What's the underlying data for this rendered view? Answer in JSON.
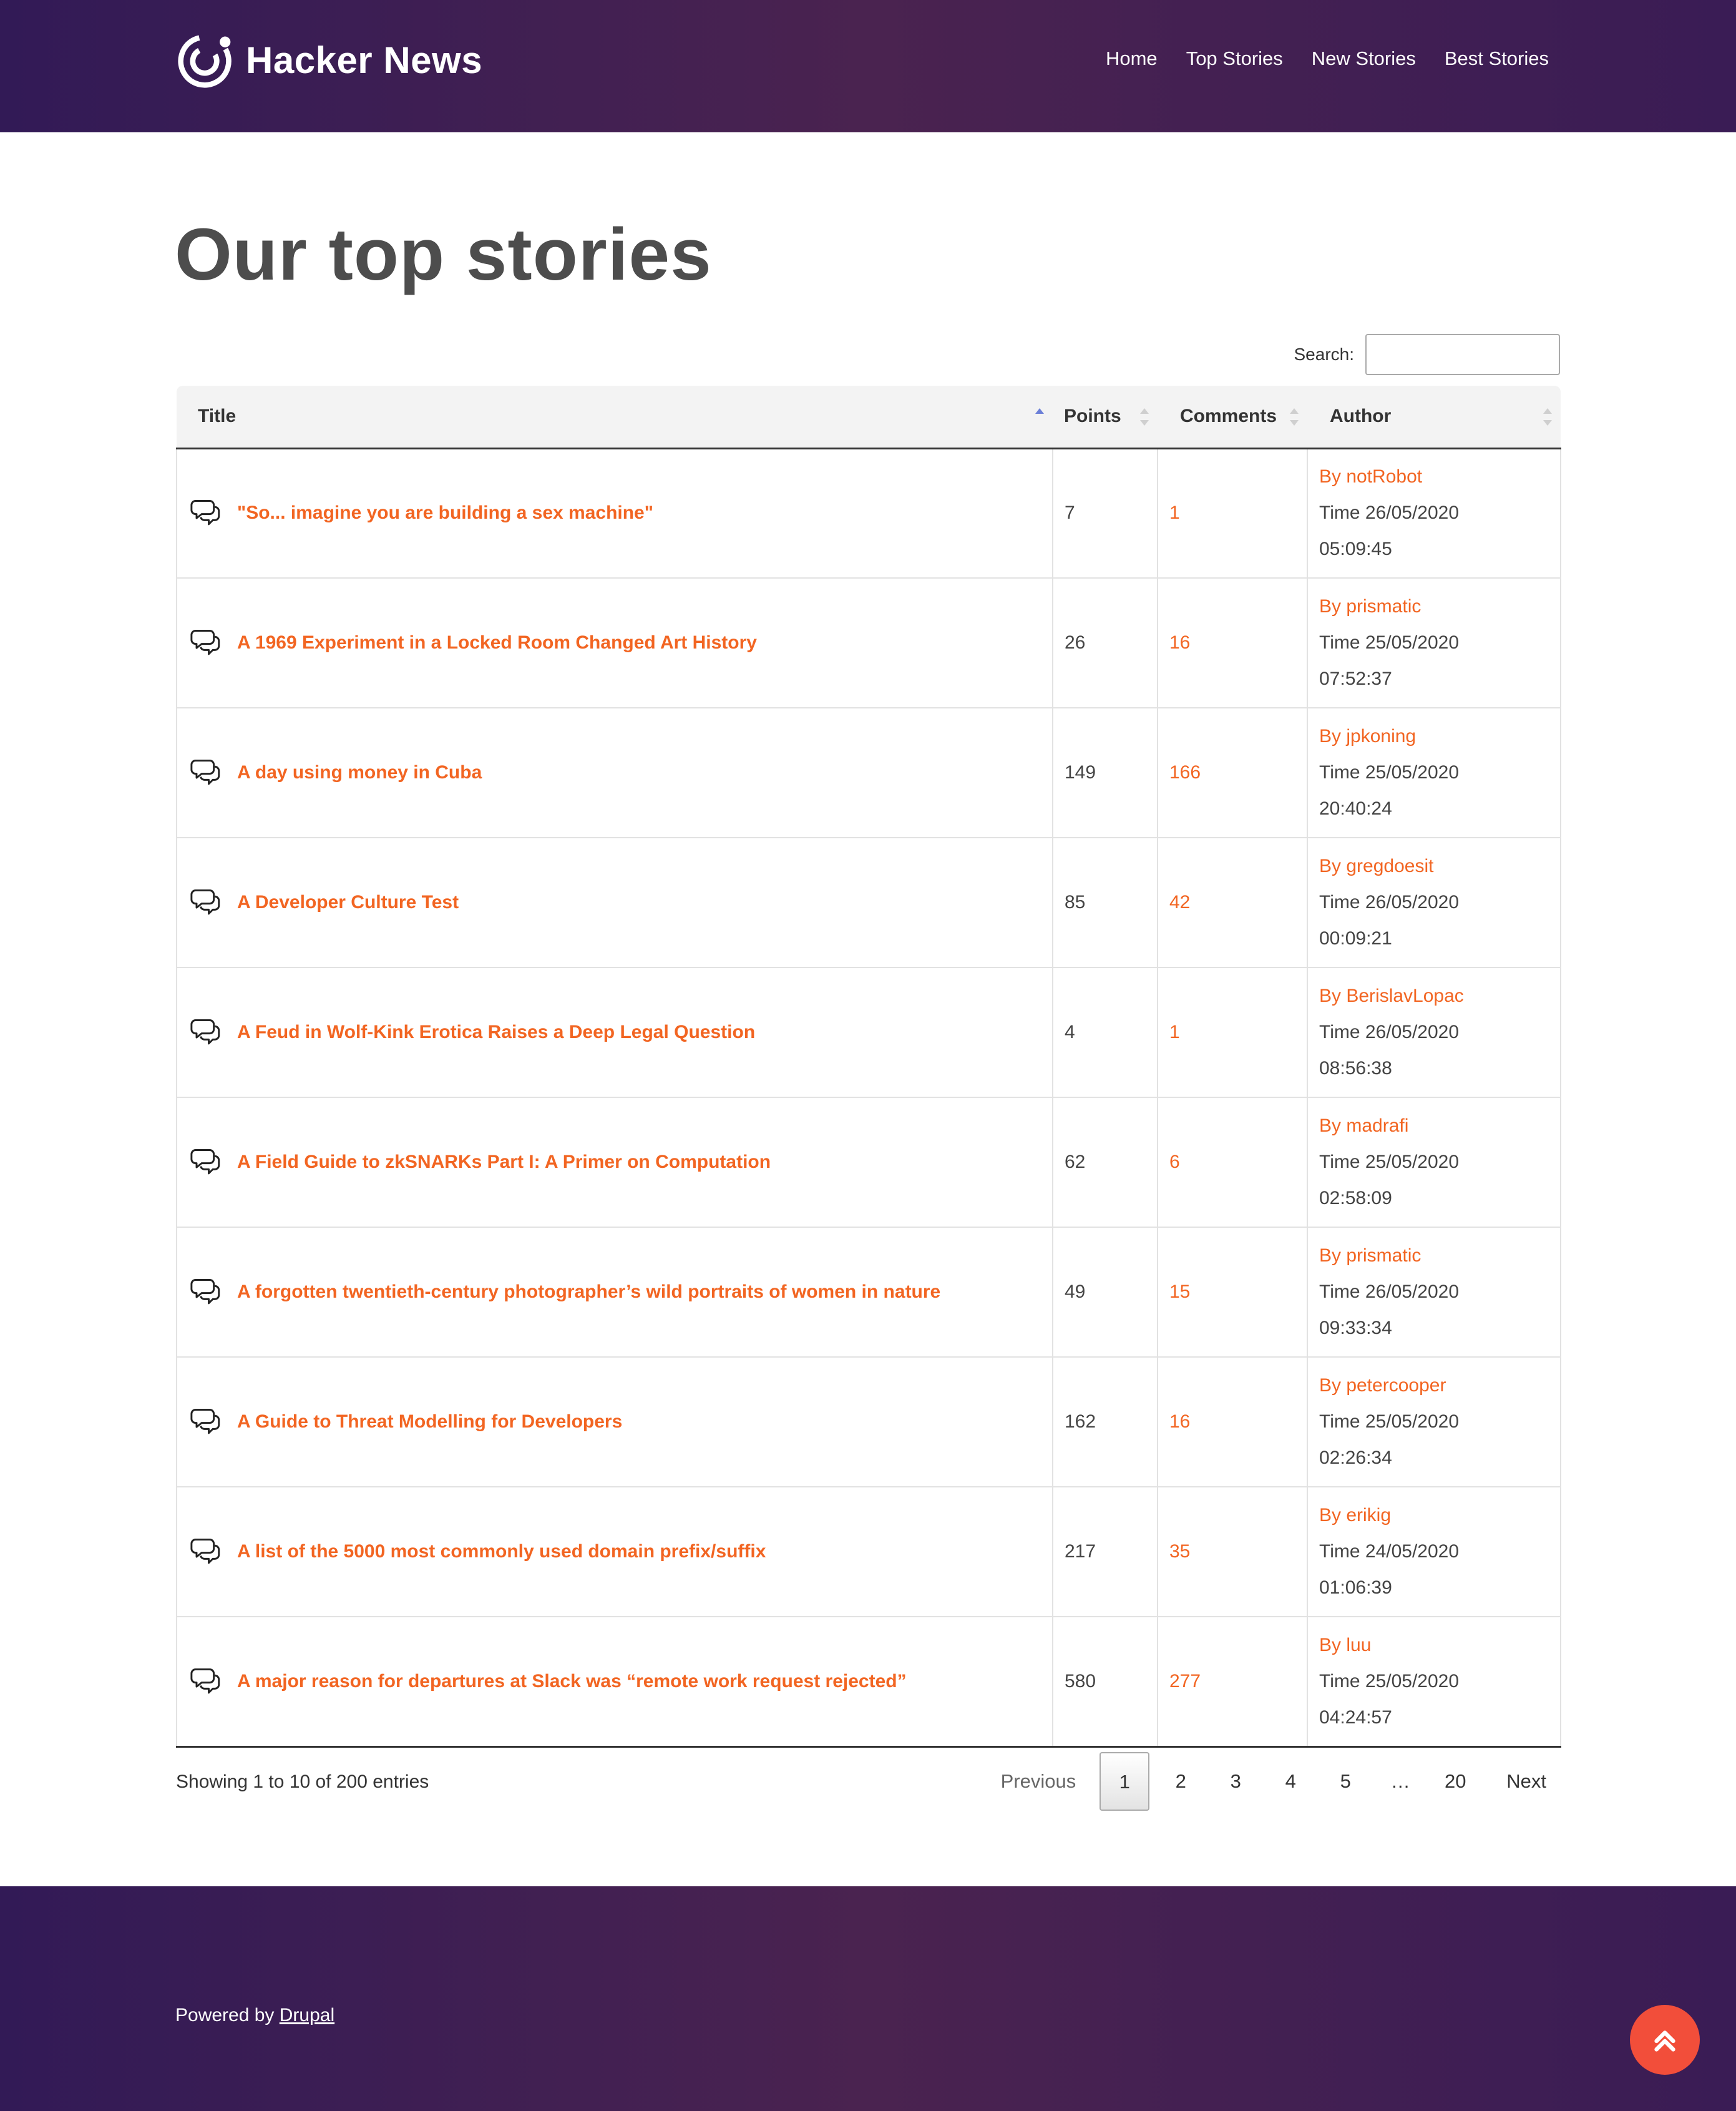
{
  "header": {
    "site_name": "Hacker News",
    "nav": [
      "Home",
      "Top Stories",
      "New Stories",
      "Best Stories"
    ]
  },
  "page": {
    "title": "Our top stories",
    "search_label": "Search:",
    "search_value": ""
  },
  "table": {
    "columns": [
      "Title",
      "Points",
      "Comments",
      "Author"
    ],
    "sorted_column": "Title",
    "sort_direction": "ascending",
    "rows": [
      {
        "title": "\"So... imagine you are building a sex machine\"",
        "points": "7",
        "comments": "1",
        "author": "By notRobot",
        "time": "Time 26/05/2020",
        "clock": "05:09:45"
      },
      {
        "title": "A 1969 Experiment in a Locked Room Changed Art History",
        "points": "26",
        "comments": "16",
        "author": "By prismatic",
        "time": "Time 25/05/2020",
        "clock": "07:52:37"
      },
      {
        "title": "A day using money in Cuba",
        "points": "149",
        "comments": "166",
        "author": "By jpkoning",
        "time": "Time 25/05/2020",
        "clock": "20:40:24"
      },
      {
        "title": "A Developer Culture Test",
        "points": "85",
        "comments": "42",
        "author": "By gregdoesit",
        "time": "Time 26/05/2020",
        "clock": "00:09:21"
      },
      {
        "title": "A Feud in Wolf-Kink Erotica Raises a Deep Legal Question",
        "points": "4",
        "comments": "1",
        "author": "By BerislavLopac",
        "time": "Time 26/05/2020",
        "clock": "08:56:38"
      },
      {
        "title": "A Field Guide to zkSNARKs Part I: A Primer on Computation",
        "points": "62",
        "comments": "6",
        "author": "By madrafi",
        "time": "Time 25/05/2020",
        "clock": "02:58:09"
      },
      {
        "title": "A forgotten twentieth-century photographer’s wild portraits of women in nature",
        "points": "49",
        "comments": "15",
        "author": "By prismatic",
        "time": "Time 26/05/2020",
        "clock": "09:33:34"
      },
      {
        "title": "A Guide to Threat Modelling for Developers",
        "points": "162",
        "comments": "16",
        "author": "By petercooper",
        "time": "Time 25/05/2020",
        "clock": "02:26:34"
      },
      {
        "title": "A list of the 5000 most commonly used domain prefix/suffix",
        "points": "217",
        "comments": "35",
        "author": "By erikig",
        "time": "Time 24/05/2020",
        "clock": "01:06:39"
      },
      {
        "title": "A major reason for departures at Slack was “remote work request rejected”",
        "points": "580",
        "comments": "277",
        "author": "By luu",
        "time": "Time 25/05/2020",
        "clock": "04:24:57"
      }
    ]
  },
  "info": "Showing 1 to 10 of 200 entries",
  "pagination": {
    "previous": "Previous",
    "pages": [
      "1",
      "2",
      "3",
      "4",
      "5",
      "…",
      "20"
    ],
    "current": "1",
    "next": "Next"
  },
  "footer": {
    "powered_by": "Powered by ",
    "powered_link": "Drupal"
  },
  "icons": {
    "logo": "drupal-swirl-logo-icon",
    "row_icon": "comments-icon",
    "scroll_top": "double-chevron-up-icon"
  },
  "colors": {
    "header_bg": "#3a1c55",
    "accent": "#f26522",
    "scroll_top_bg": "#f24e3a",
    "sort_active": "#6b7fd7"
  }
}
